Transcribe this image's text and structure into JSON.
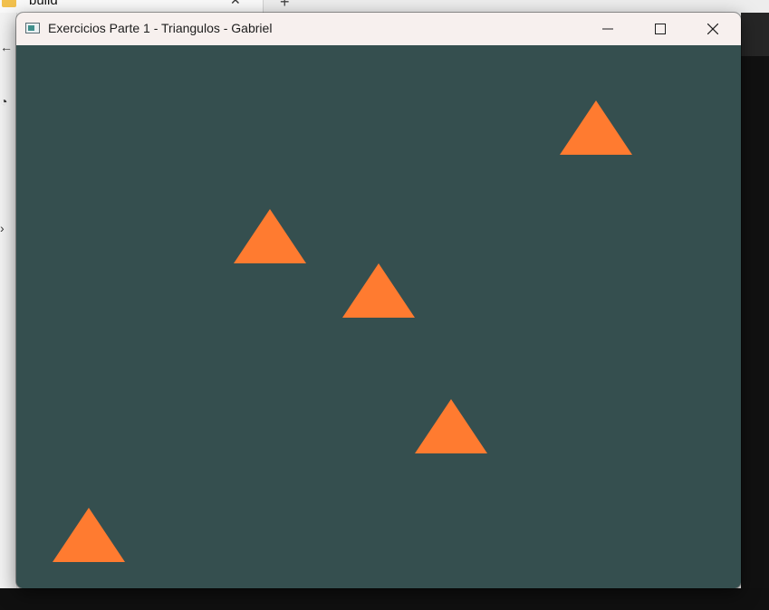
{
  "background_window": {
    "tab_title": "build"
  },
  "window": {
    "title": "Exercicios Parte 1 - Triangulos - Gabriel",
    "controls": {
      "minimize_icon": "minimize-icon",
      "maximize_icon": "maximize-icon",
      "close_icon": "close-icon"
    }
  },
  "scene": {
    "background_color": "#354f4f",
    "triangle_color": "#ff7b30",
    "triangle_count": 5
  },
  "colors": {
    "titlebar": "#f7f0ee",
    "taskbar_dark": "#111111"
  }
}
